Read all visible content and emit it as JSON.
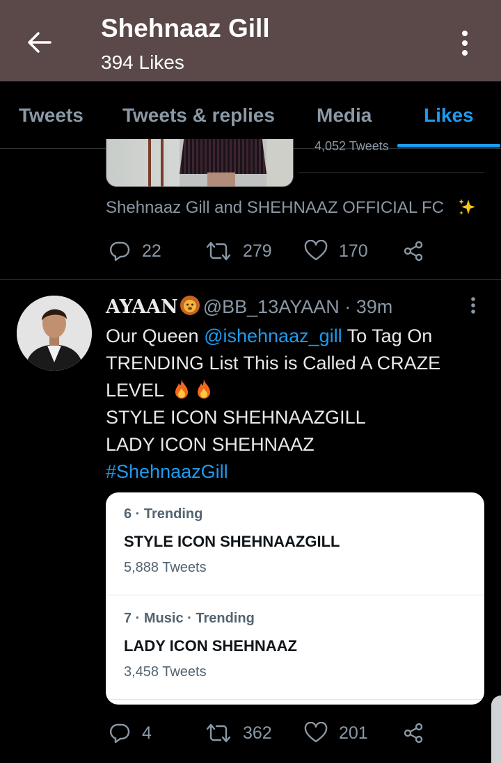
{
  "header": {
    "title": "Shehnaaz Gill",
    "subtitle": "394 Likes"
  },
  "tabs": [
    {
      "label": "Tweets"
    },
    {
      "label": "Tweets & replies"
    },
    {
      "label": "Media"
    },
    {
      "label": "Likes"
    }
  ],
  "active_tab": "Likes",
  "previous_tweet": {
    "trend_count": "4,052 Tweets",
    "social_context": "Shehnaaz Gill and SHEHNAAZ OFFICIAL FC",
    "replies": "22",
    "retweets": "279",
    "likes": "170"
  },
  "tweet": {
    "name": "AYAAN",
    "handle": "@BB_13AYAAN",
    "time": "· 39m",
    "lines": {
      "l1_pre": "Our Queen ",
      "l1_mention": "@ishehnaaz_gill",
      "l1_post": " To Tag On",
      "l2": "TRENDING List This is Called A CRAZE",
      "l3": "LEVEL",
      "l4": "STYLE ICON SHEHNAAZGILL",
      "l5": "LADY ICON SHEHNAAZ",
      "l6_hashtag": "#ShehnaazGill"
    },
    "trends": [
      {
        "context": "6 · Trending",
        "name": "STYLE ICON SHEHNAAZGILL",
        "count": "5,888 Tweets"
      },
      {
        "context": "7 · Music · Trending",
        "name": "LADY ICON SHEHNAAZ",
        "count": "3,458 Tweets"
      }
    ],
    "replies": "4",
    "retweets": "362",
    "likes": "201"
  },
  "icons": {
    "back": "back-arrow-icon",
    "menu": "more-vertical-icon",
    "reply": "reply-icon",
    "retweet": "retweet-icon",
    "like": "heart-icon",
    "share": "share-icon"
  },
  "colors": {
    "header_bg": "#5b4848",
    "accent": "#1d9bf0",
    "background": "#000000",
    "muted": "#8b98a5"
  }
}
